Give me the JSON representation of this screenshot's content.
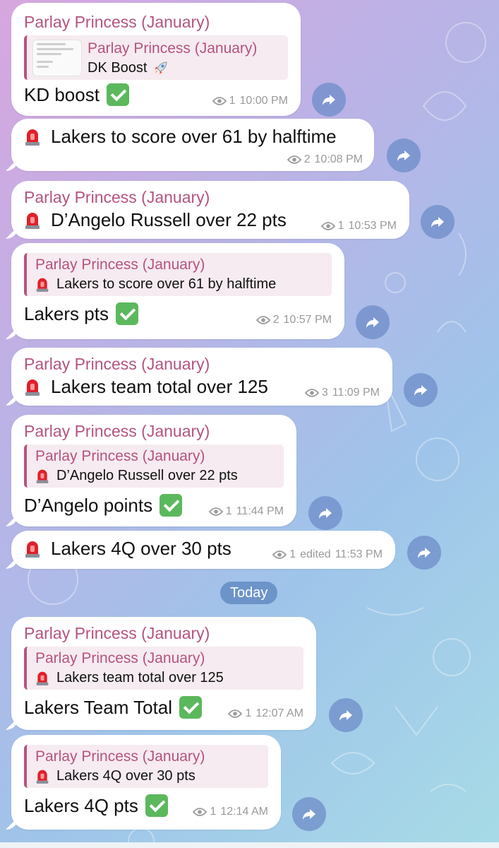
{
  "messages": [
    {
      "sender": "Parlay Princess (January)",
      "reply": {
        "sender": "Parlay Princess (January)",
        "text": "DK Boost"
      },
      "text": "KD boost",
      "check": true,
      "views": "1",
      "time": "10:00 PM"
    },
    {
      "text": "Lakers to score over 61 by halftime",
      "siren": true,
      "views": "2",
      "time": "10:08 PM"
    },
    {
      "sender": "Parlay Princess (January)",
      "text": "D’Angelo Russell over 22 pts",
      "siren": true,
      "views": "1",
      "time": "10:53 PM"
    },
    {
      "reply": {
        "sender": "Parlay Princess (January)",
        "text": "Lakers to score over 61 by halftime"
      },
      "text": "Lakers pts",
      "check": true,
      "views": "2",
      "time": "10:57 PM"
    },
    {
      "sender": "Parlay Princess (January)",
      "text": "Lakers team total over 125",
      "siren": true,
      "views": "3",
      "time": "11:09 PM"
    },
    {
      "sender": "Parlay Princess (January)",
      "reply": {
        "sender": "Parlay Princess (January)",
        "text": "D’Angelo Russell over 22 pts"
      },
      "text": "D’Angelo points",
      "check": true,
      "views": "1",
      "time": "11:44 PM"
    },
    {
      "text": "Lakers 4Q over 30 pts",
      "siren": true,
      "views": "1",
      "edited": "edited",
      "time": "11:53 PM"
    },
    {
      "sender": "Parlay Princess (January)",
      "reply": {
        "sender": "Parlay Princess (January)",
        "text": "Lakers team total over 125"
      },
      "text": "Lakers Team Total",
      "check": true,
      "views": "1",
      "time": "12:07 AM"
    },
    {
      "reply": {
        "sender": "Parlay Princess (January)",
        "text": "Lakers 4Q over 30 pts"
      },
      "text": "Lakers 4Q pts",
      "check": true,
      "views": "1",
      "time": "12:14 AM"
    }
  ],
  "date_separator": "Today",
  "colors": {
    "sender": "#b5547f",
    "forward_button": "#6e8cc8",
    "check": "#5cb85c",
    "siren": "#e0202a"
  },
  "icons": {
    "siren": "rotating-light-icon",
    "check": "check-mark-button-icon",
    "eye": "eye-icon",
    "forward": "share-arrow-icon",
    "rocket": "rocket-icon"
  }
}
